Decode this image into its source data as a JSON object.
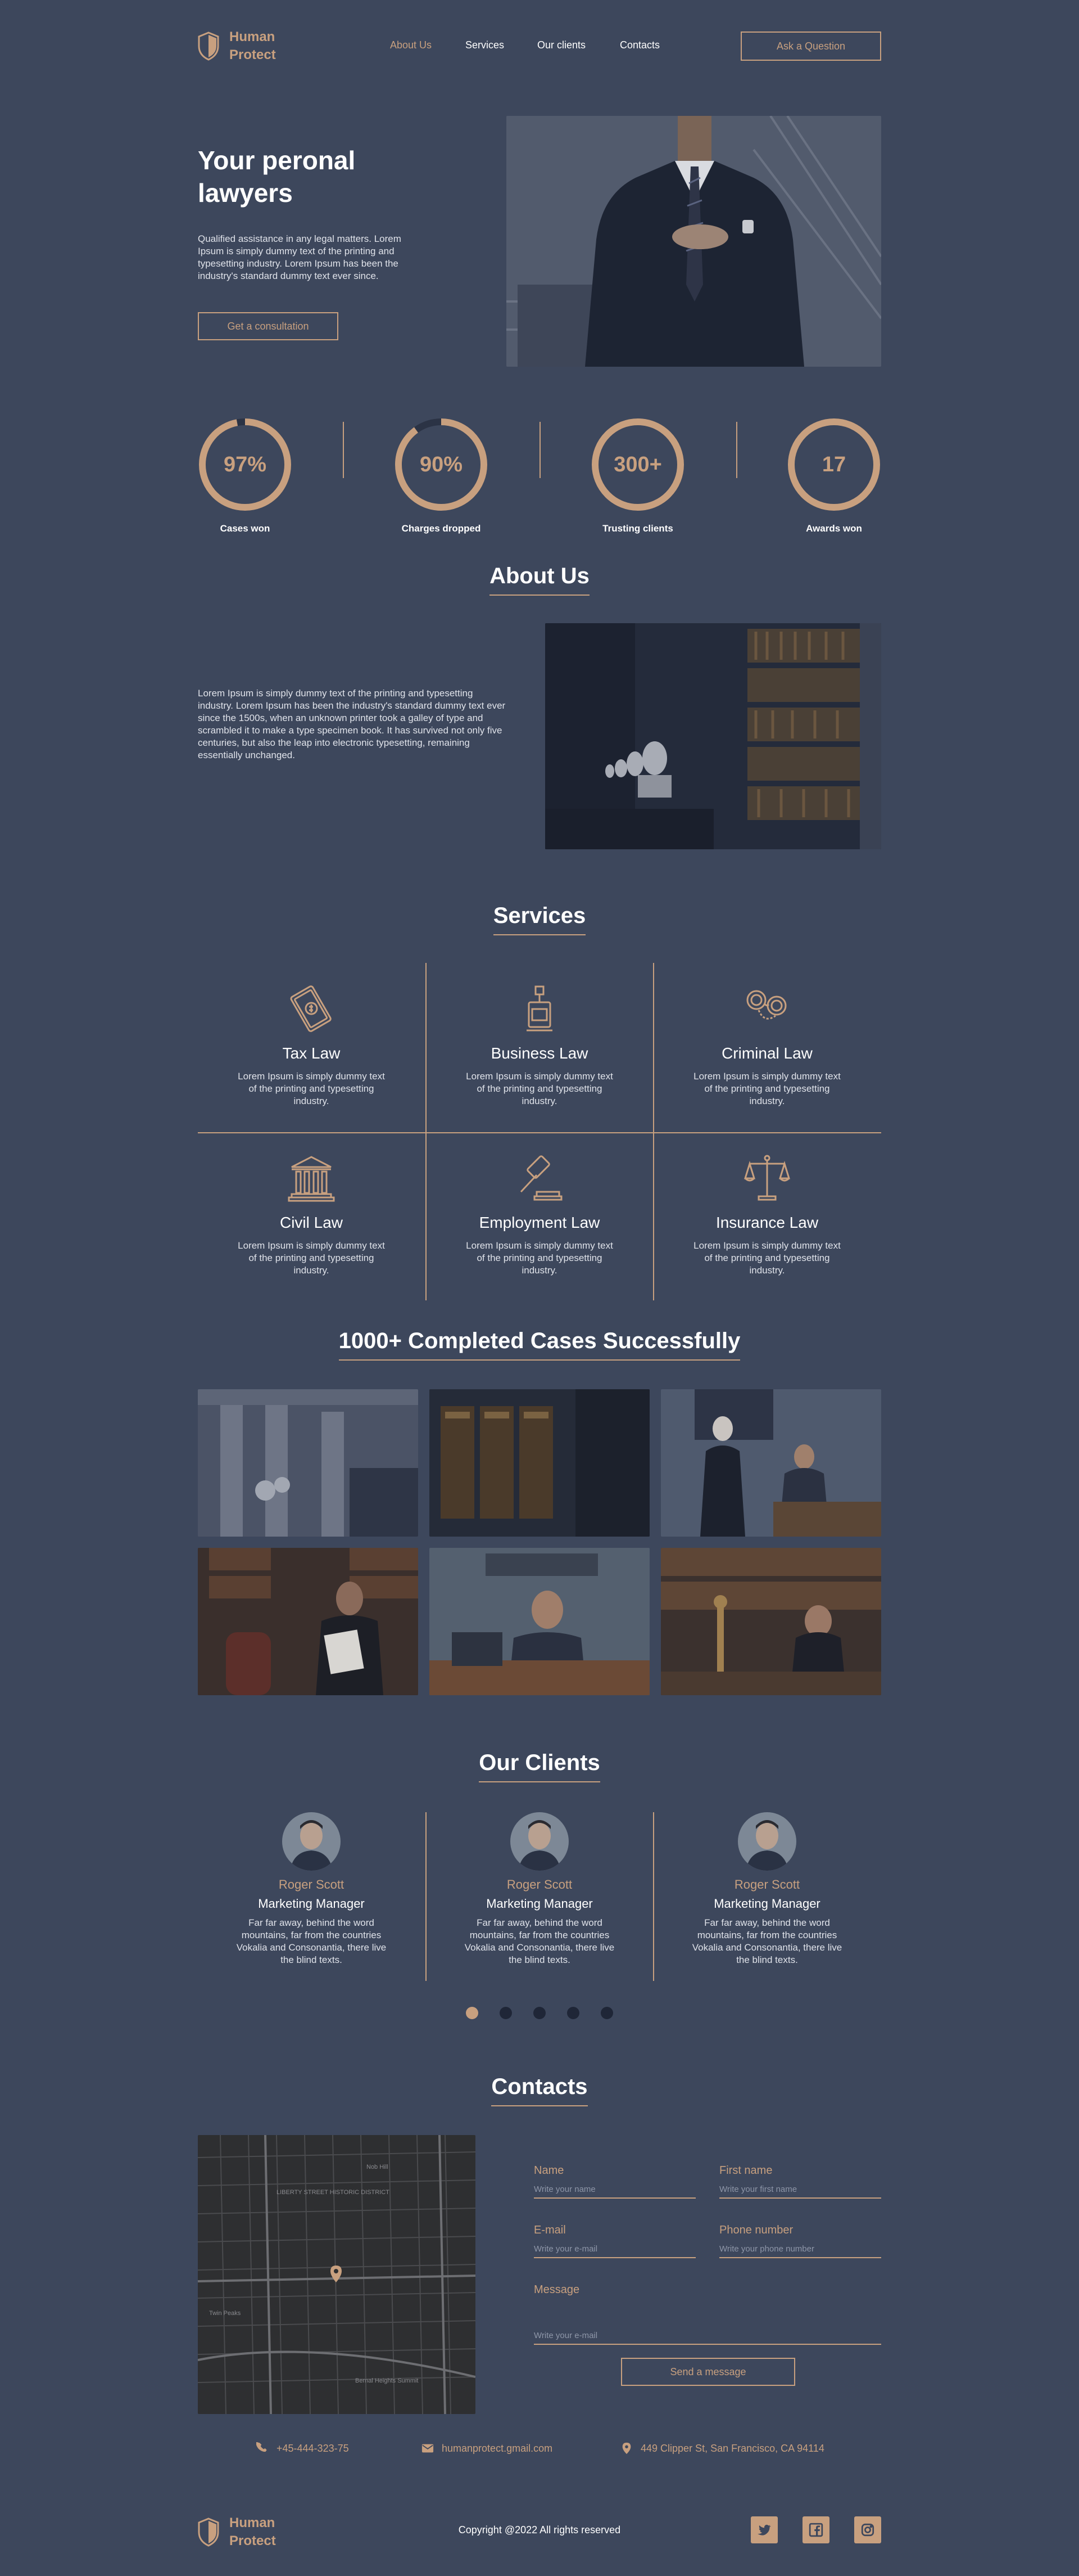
{
  "header": {
    "logo_line1": "Human",
    "logo_line2": "Protect",
    "nav": [
      "About Us",
      "Services",
      "Our clients",
      "Contacts"
    ],
    "ask_button": "Ask a Question"
  },
  "hero": {
    "title_line1": "Your peronal",
    "title_line2": "lawyers",
    "text": "Qualified assistance in any legal matters. Lorem Ipsum is simply dummy text of the printing and typesetting industry. Lorem Ipsum has been the industry's standard dummy text ever since.",
    "cta": "Get a consultation"
  },
  "stats": [
    {
      "value": "97%",
      "label": "Cases won",
      "fill": 0.97
    },
    {
      "value": "90%",
      "label": "Charges dropped",
      "fill": 0.9
    },
    {
      "value": "300+",
      "label": "Trusting clients",
      "fill": 1.0
    },
    {
      "value": "17",
      "label": "Awards won",
      "fill": 1.0
    }
  ],
  "about": {
    "title": "About Us",
    "text": "Lorem Ipsum is simply dummy text of the printing and typesetting industry. Lorem Ipsum has been the industry's standard dummy text ever since the 1500s, when an unknown printer took a galley of type and scrambled it to make a type specimen book. It has survived not only five centuries, but also the leap into electronic typesetting, remaining essentially unchanged."
  },
  "services": {
    "title": "Services",
    "items": [
      {
        "name": "Tax Law",
        "icon": "money-icon",
        "text": "Lorem Ipsum is simply dummy text of the printing and typesetting industry."
      },
      {
        "name": "Business Law",
        "icon": "briefcase-lamp-icon",
        "text": "Lorem Ipsum is simply dummy text of the printing and typesetting industry."
      },
      {
        "name": "Criminal Law",
        "icon": "handcuffs-icon",
        "text": "Lorem Ipsum is simply dummy text of the printing and typesetting industry."
      },
      {
        "name": "Civil Law",
        "icon": "courthouse-icon",
        "text": "Lorem Ipsum is simply dummy text of the printing and typesetting industry."
      },
      {
        "name": "Employment Law",
        "icon": "gavel-icon",
        "text": "Lorem Ipsum is simply dummy text of the printing and typesetting industry."
      },
      {
        "name": "Insurance Law",
        "icon": "scales-icon",
        "text": "Lorem Ipsum is simply dummy text of the printing and typesetting industry."
      }
    ]
  },
  "cases": {
    "title": "1000+ Completed Cases Successfully"
  },
  "clients": {
    "title": "Our Clients",
    "items": [
      {
        "name": "Roger Scott",
        "role": "Marketing Manager",
        "text": "Far far away, behind the word mountains, far from the countries Vokalia and Consonantia, there live the blind texts."
      },
      {
        "name": "Roger Scott",
        "role": "Marketing Manager",
        "text": "Far far away, behind the word mountains, far from the countries Vokalia and Consonantia, there live the blind texts."
      },
      {
        "name": "Roger Scott",
        "role": "Marketing Manager",
        "text": "Far far away, behind the word mountains, far from the countries Vokalia and Consonantia, there live the blind texts."
      }
    ],
    "dots": 5,
    "active_dot": 0
  },
  "contacts": {
    "title": "Contacts",
    "form": {
      "name_label": "Name",
      "name_placeholder": "Write your name",
      "first_label": "First name",
      "first_placeholder": "Write your first name",
      "email_label": "E-mail",
      "email_placeholder": "Write your e-mail",
      "phone_label": "Phone number",
      "phone_placeholder": "Write your phone number",
      "message_label": "Message",
      "message_placeholder": "Write your e-mail",
      "send": "Send a message"
    },
    "map_labels": [
      "LIBERTY STREET HISTORIC DISTRICT",
      "Bernal Heights Summit",
      "Nob Hill",
      "Twin Peaks"
    ],
    "phone": "+45-444-323-75",
    "email": "humanprotect.gmail.com",
    "address": "449 Clipper St, San Francisco, CA 94114"
  },
  "footer": {
    "logo_line1": "Human",
    "logo_line2": "Protect",
    "copyright": "Copyright @2022 All rights reserved",
    "socials": [
      "twitter-icon",
      "facebook-icon",
      "instagram-icon"
    ]
  },
  "colors": {
    "background": "#3d475c",
    "accent": "#c8a07f",
    "dark": "#1f2637"
  }
}
